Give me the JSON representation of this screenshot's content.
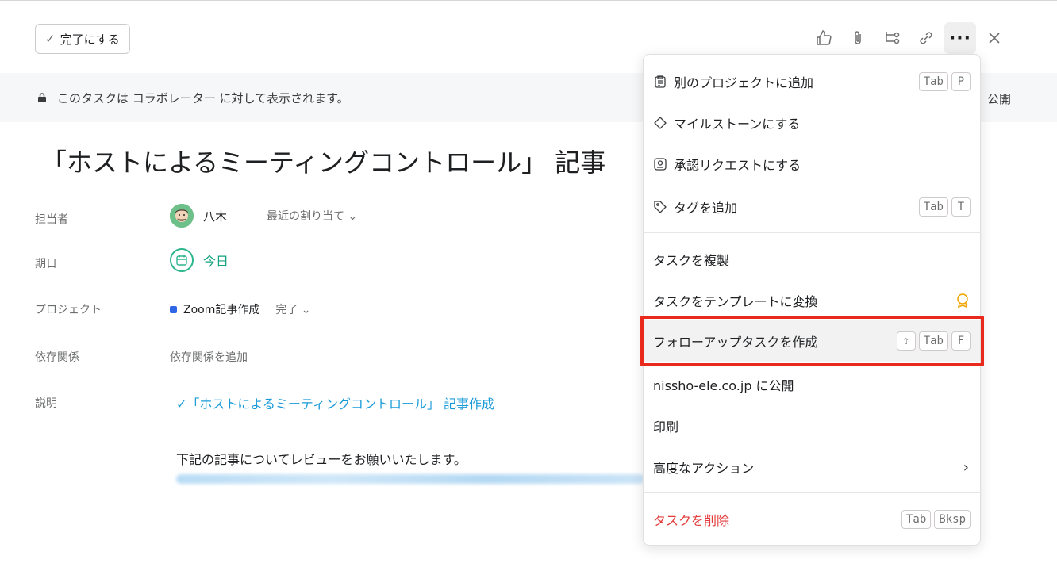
{
  "toolbar": {
    "complete_label": "完了にする",
    "icons": [
      "thumbs-up-icon",
      "paperclip-icon",
      "subtask-icon",
      "link-icon",
      "more-icon",
      "close-icon"
    ]
  },
  "banner": {
    "text": "このタスクは コラボレーター に対して表示されます。",
    "right_text": "公開"
  },
  "task": {
    "title": "「ホストによるミーティングコントロール」 記事"
  },
  "fields": {
    "assignee": {
      "label": "担当者",
      "value": "八木",
      "recent": "最近の割り当て ⌄"
    },
    "due": {
      "label": "期日",
      "value": "今日"
    },
    "project": {
      "label": "プロジェクト",
      "value": "Zoom記事作成",
      "status": "完了 ⌄",
      "color": "#2f66e6"
    },
    "dependencies": {
      "label": "依存関係",
      "value": "依存関係を追加"
    },
    "description": {
      "label": "説明",
      "link": "✓「ホストによるミーティングコントロール」 記事作成",
      "body": "下記の記事についてレビューをお願いいたします。"
    }
  },
  "menu": {
    "items": [
      {
        "label": "別のプロジェクトに追加",
        "icon": "clipboard-icon",
        "keys": [
          "Tab",
          "P"
        ]
      },
      {
        "label": "マイルストーンにする",
        "icon": "diamond-icon",
        "keys": []
      },
      {
        "label": "承認リクエストにする",
        "icon": "approval-icon",
        "keys": []
      },
      {
        "label": "タグを追加",
        "icon": "tag-icon",
        "keys": [
          "Tab",
          "T"
        ]
      },
      {
        "label": "タスクを複製",
        "keys": []
      },
      {
        "label": "タスクをテンプレートに変換",
        "icon": "premium-badge-icon",
        "keys": []
      },
      {
        "label": "フォローアップタスクを作成",
        "keys": [
          "⇧",
          "Tab",
          "F"
        ]
      },
      {
        "label": "nissho-ele.co.jp に公開",
        "keys": []
      },
      {
        "label": "印刷",
        "keys": []
      },
      {
        "label": "高度なアクション",
        "keys": []
      },
      {
        "label": "タスクを削除",
        "keys": [
          "Tab",
          "Bksp"
        ]
      }
    ]
  },
  "colors": {
    "accent_green": "#14a37f",
    "link_blue": "#1a9bd8",
    "danger_red": "#e23c3c",
    "highlight_red": "#e8291b"
  }
}
